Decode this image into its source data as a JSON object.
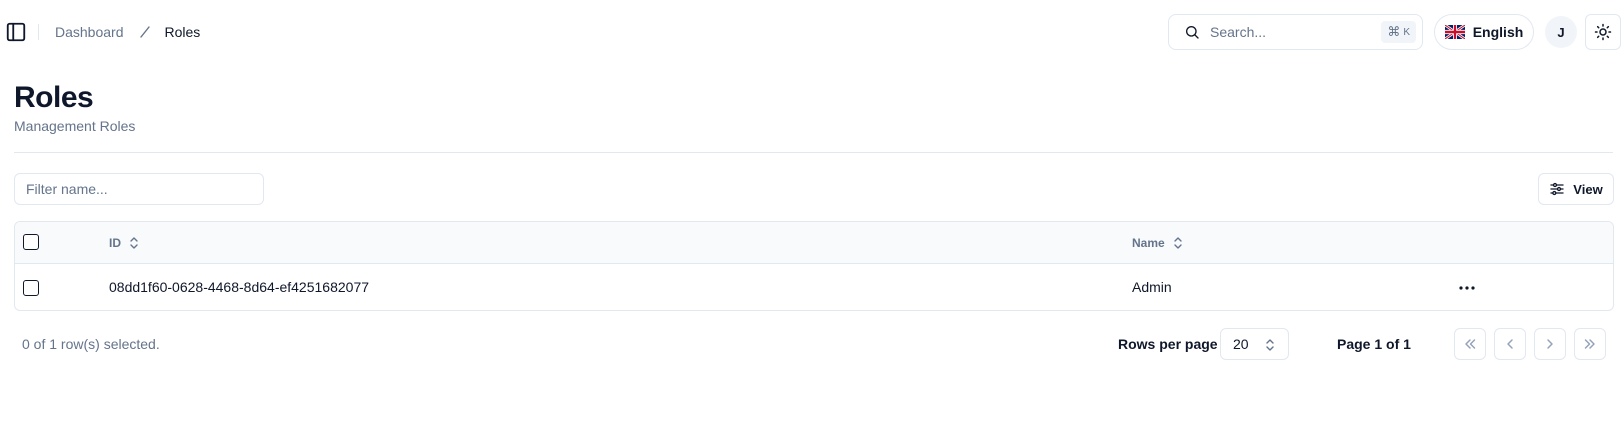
{
  "header": {
    "breadcrumb": {
      "parent": "Dashboard",
      "current": "Roles"
    },
    "search": {
      "placeholder": "Search...",
      "shortcut_symbol": "⌘",
      "shortcut_key": "K"
    },
    "language": {
      "label": "English",
      "flag_icon": "uk-flag-icon"
    },
    "user_avatar_initial": "J",
    "theme_icon": "sun-icon"
  },
  "page": {
    "title": "Roles",
    "subtitle": "Management Roles"
  },
  "toolbar": {
    "filter_placeholder": "Filter name...",
    "view_label": "View"
  },
  "table": {
    "columns": [
      "ID",
      "Name"
    ],
    "rows": [
      {
        "id": "08dd1f60-0628-4468-8d64-ef4251682077",
        "name": "Admin",
        "selected": false
      }
    ]
  },
  "footer": {
    "selected_text": "0 of 1 row(s) selected.",
    "rows_per_page_label": "Rows per page",
    "rows_per_page_value": "20",
    "page_info": "Page 1 of 1"
  },
  "colors": {
    "text": "#0f172a",
    "muted": "#64748b",
    "border": "#e2e8f0",
    "header_bg": "#f8fafc"
  }
}
